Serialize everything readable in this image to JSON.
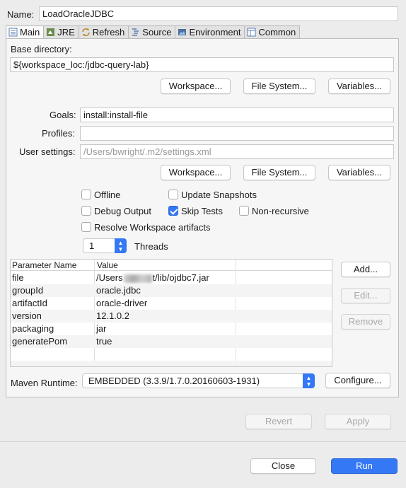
{
  "name_label": "Name:",
  "name_value": "LoadOracleJDBC",
  "tabs": [
    {
      "label": "Main",
      "icon": "main-icon"
    },
    {
      "label": "JRE",
      "icon": "jre-icon"
    },
    {
      "label": "Refresh",
      "icon": "refresh-icon"
    },
    {
      "label": "Source",
      "icon": "source-icon"
    },
    {
      "label": "Environment",
      "icon": "environment-icon"
    },
    {
      "label": "Common",
      "icon": "common-icon"
    }
  ],
  "base_dir": {
    "label": "Base directory:",
    "value": "${workspace_loc:/jdbc-query-lab}",
    "workspace_btn": "Workspace...",
    "filesystem_btn": "File System...",
    "variables_btn": "Variables..."
  },
  "goals": {
    "label": "Goals:",
    "value": "install:install-file"
  },
  "profiles": {
    "label": "Profiles:",
    "value": ""
  },
  "user_settings": {
    "label": "User settings:",
    "value": "/Users/bwright/.m2/settings.xml",
    "workspace_btn": "Workspace...",
    "filesystem_btn": "File System...",
    "variables_btn": "Variables..."
  },
  "options": {
    "offline": {
      "label": "Offline",
      "checked": false
    },
    "update_snapshots": {
      "label": "Update Snapshots",
      "checked": false
    },
    "debug_output": {
      "label": "Debug Output",
      "checked": false
    },
    "skip_tests": {
      "label": "Skip Tests",
      "checked": true
    },
    "non_recursive": {
      "label": "Non-recursive",
      "checked": false
    },
    "resolve_workspace": {
      "label": "Resolve Workspace artifacts",
      "checked": false
    }
  },
  "threads": {
    "value": "1",
    "label": "Threads"
  },
  "params": {
    "headers": [
      "Parameter Name",
      "Value"
    ],
    "rows": [
      {
        "name": "file",
        "value_prefix": "/Users",
        "value_suffix": "t/lib/ojdbc7.jar"
      },
      {
        "name": "groupId",
        "value": "oracle.jdbc"
      },
      {
        "name": "artifactId",
        "value": "oracle-driver"
      },
      {
        "name": "version",
        "value": "12.1.0.2"
      },
      {
        "name": "packaging",
        "value": "jar"
      },
      {
        "name": "generatePom",
        "value": "true"
      }
    ],
    "add_btn": "Add...",
    "edit_btn": "Edit...",
    "remove_btn": "Remove"
  },
  "runtime": {
    "label": "Maven Runtime:",
    "value": "EMBEDDED (3.3.9/1.7.0.20160603-1931)",
    "configure_btn": "Configure..."
  },
  "revert_btn": "Revert",
  "apply_btn": "Apply",
  "close_btn": "Close",
  "run_btn": "Run",
  "colors": {
    "accent": "#3478f6",
    "panel": "#f6f6f6",
    "window": "#ececec"
  }
}
